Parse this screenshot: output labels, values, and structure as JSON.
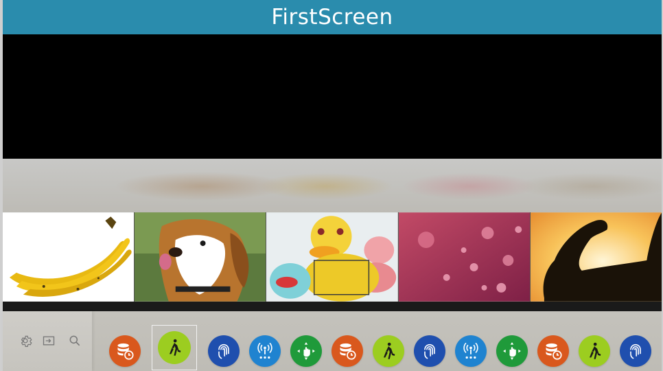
{
  "window": {
    "title": "FirstScreen"
  },
  "thumbnails": [
    {
      "name": "bananas"
    },
    {
      "name": "beagle"
    },
    {
      "name": "rubber-ducks"
    },
    {
      "name": "water-droplets"
    },
    {
      "name": "arm-silhouette"
    }
  ],
  "utility_icons": [
    "settings-icon",
    "input-source-icon",
    "search-icon"
  ],
  "apps": [
    {
      "icon": "database-clock-icon",
      "color": "#d9581d",
      "selected": false
    },
    {
      "icon": "walking-person-icon",
      "color": "#9ccd20",
      "selected": true
    },
    {
      "icon": "fingerprint-icon",
      "color": "#1f4fae",
      "selected": false
    },
    {
      "icon": "wireless-signal-icon",
      "color": "#1f83d0",
      "selected": false
    },
    {
      "icon": "hand-gesture-icon",
      "color": "#1f9a3a",
      "selected": false
    },
    {
      "icon": "database-clock-icon",
      "color": "#d9581d",
      "selected": false
    },
    {
      "icon": "walking-person-icon",
      "color": "#9ccd20",
      "selected": false
    },
    {
      "icon": "fingerprint-icon",
      "color": "#1f4fae",
      "selected": false
    },
    {
      "icon": "wireless-signal-icon",
      "color": "#1f83d0",
      "selected": false
    },
    {
      "icon": "hand-gesture-icon",
      "color": "#1f9a3a",
      "selected": false
    },
    {
      "icon": "database-clock-icon",
      "color": "#d9581d",
      "selected": false
    },
    {
      "icon": "walking-person-icon",
      "color": "#9ccd20",
      "selected": false
    },
    {
      "icon": "fingerprint-icon",
      "color": "#1f4fae",
      "selected": false
    }
  ]
}
